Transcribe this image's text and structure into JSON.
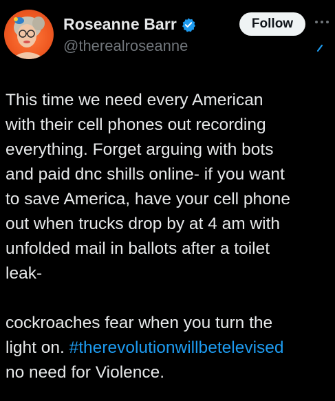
{
  "user": {
    "display_name": "Roseanne Barr",
    "handle": "@therealroseanne",
    "verified": true
  },
  "actions": {
    "follow_label": "Follow"
  },
  "icons": {
    "verified": "verified-badge-icon",
    "more": "more-options-icon",
    "grok": "grok-icon"
  },
  "colors": {
    "background": "#000000",
    "text": "#e7e9ea",
    "secondary_text": "#71767b",
    "link": "#1d9bf0",
    "verified": "#1d9bf0"
  },
  "tweet": {
    "paragraph1": "This time we need every American\nwith their cell phones out recording\neverything. Forget arguing with bots\nand paid dnc shills online- if you want\nto save America, have your cell phone\nout when trucks drop by at 4 am with\nunfolded mail in ballots after a toilet\nleak-",
    "paragraph2_before": "cockroaches fear when you turn the\nlight on. ",
    "hashtag": "#therevolutionwillbetelevised",
    "paragraph2_after": "\nno need for Violence."
  }
}
